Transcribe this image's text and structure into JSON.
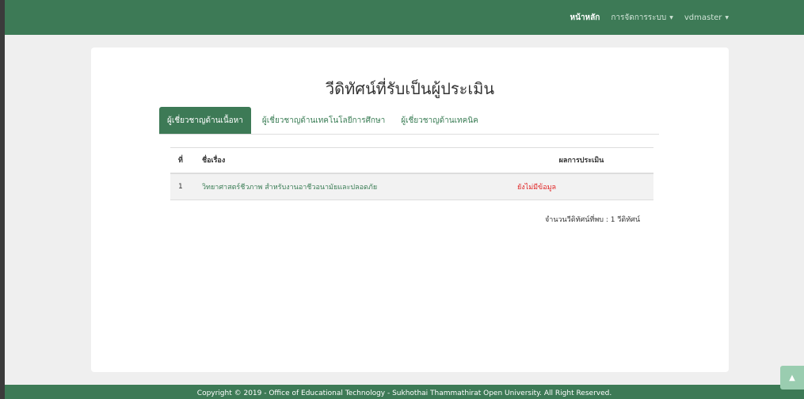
{
  "nav": {
    "home": "หน้าหลัก",
    "manage": "การจัดการระบบ",
    "user": "vdmaster"
  },
  "page_title": "วีดิทัศน์ที่รับเป็นผู้ประเมิน",
  "tabs": [
    {
      "label": "ผู้เชี่ยวชาญด้านเนื้อหา",
      "active": true
    },
    {
      "label": "ผู้เชี่ยวชาญด้านเทคโนโลยีการศึกษา",
      "active": false
    },
    {
      "label": "ผู้เชี่ยวชาญด้านเทคนิค",
      "active": false
    }
  ],
  "table": {
    "headers": [
      "ที่",
      "ชื่อเรื่อง",
      "ผลการประเมิน"
    ],
    "rows": [
      {
        "no": "1",
        "title": "วิทยาศาสตร์ชีวภาพ สำหรับงานอาชีวอนามัยและปลอดภัย",
        "result": "ยังไม่มีข้อมูล"
      }
    ]
  },
  "count_text": "จำนวนวีดิทัศน์ที่พบ : 1 วีดิทัศน์",
  "footer": "Copyright © 2019 - Office of Educational Technology - Sukhothai Thammathirat Open University. All Right Reserved.",
  "colors": {
    "primary": "#3d7a56",
    "status_red": "#e02424"
  },
  "icons": {
    "scroll_top": "chevron-up-icon"
  }
}
